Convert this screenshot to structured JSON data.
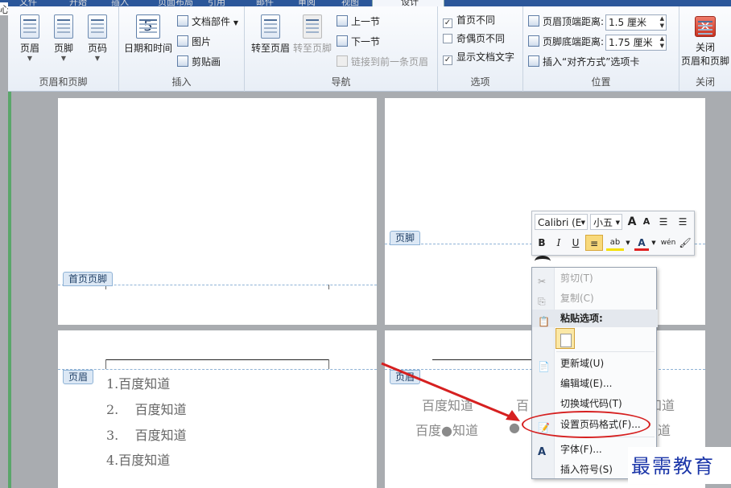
{
  "window": {
    "edge_glyph": "心",
    "ribbon_tabs": [
      {
        "label": "文件"
      },
      {
        "label": "开始"
      },
      {
        "label": "插入"
      },
      {
        "label": "页面布局"
      },
      {
        "label": "引用"
      },
      {
        "label": "邮件"
      },
      {
        "label": "审阅"
      },
      {
        "label": "视图"
      },
      {
        "label": "设计"
      }
    ]
  },
  "ribbon": {
    "group_header_footer": {
      "label": "页眉和页脚",
      "header": "页眉",
      "footer": "页脚",
      "page_number": "页码"
    },
    "group_insert": {
      "label": "插入",
      "date_time": "日期和时间",
      "date_icon_glyph": "5",
      "doc_parts": "文档部件",
      "picture": "图片",
      "clip_art": "剪贴画"
    },
    "group_navigation": {
      "label": "导航",
      "goto_header": "转至页眉",
      "goto_footer": "转至页脚",
      "prev_section": "上一节",
      "next_section": "下一节",
      "link_previous": "链接到前一条页眉"
    },
    "group_options": {
      "label": "选项",
      "diff_first_page": "首页不同",
      "diff_first_page_checked": true,
      "diff_odd_even": "奇偶页不同",
      "diff_odd_even_checked": false,
      "show_doc_text": "显示文档文字",
      "show_doc_text_checked": true
    },
    "group_position": {
      "label": "位置",
      "header_top_label": "页眉顶端距离:",
      "header_top_value": "1.5 厘米",
      "footer_bottom_label": "页脚底端距离:",
      "footer_bottom_value": "1.75 厘米",
      "insert_align_tab": "插入“对齐方式”选项卡"
    },
    "group_close": {
      "label": "关闭",
      "close_button": "关闭",
      "close_button_sub": "页眉和页脚",
      "close_glyph": "✕"
    }
  },
  "document": {
    "page1_footer_tag": "首页页脚",
    "page2_footer_tag": "页脚",
    "page3_header_tag": "页眉",
    "page4_header_tag": "页眉",
    "page3_list": [
      "1.百度知道",
      "2.    百度知道",
      "3.    百度知道",
      "4.百度知道"
    ],
    "page4_line1": [
      "百度知道",
      "百",
      "知道"
    ],
    "page4_line2": [
      "百度●知道",
      "●",
      "道"
    ]
  },
  "mini_toolbar": {
    "font_name": "Calibri (E",
    "font_size": "小五",
    "grow_font": "A",
    "shrink_font": "A",
    "bold": "B",
    "italic": "I",
    "underline": "U",
    "highlight": "ab",
    "font_color": "A",
    "phonetic": "wén"
  },
  "context_menu": {
    "cut": "剪切(T)",
    "copy": "复制(C)",
    "paste_options": "粘贴选项:",
    "update_field": "更新域(U)",
    "edit_field": "编辑域(E)...",
    "toggle_field_codes": "切换域代码(T)",
    "format_page_numbers": "设置页码格式(F)...",
    "font": "字体(F)...",
    "insert_symbol": "插入符号(S)"
  },
  "annotation": {
    "watermark": "最需教育",
    "arrow_color": "#d62020"
  }
}
